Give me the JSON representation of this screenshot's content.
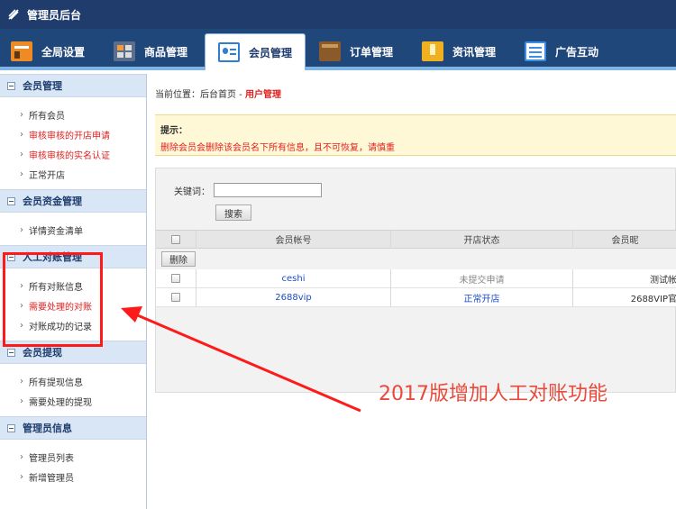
{
  "app": {
    "title": "管理员后台"
  },
  "nav": {
    "tabs": [
      {
        "label": "全局设置",
        "icon": "gear-panel-icon",
        "color": "#f08a24"
      },
      {
        "label": "商品管理",
        "icon": "grid-icon",
        "color": "#5b6f8c"
      },
      {
        "label": "会员管理",
        "icon": "member-card-icon",
        "color": "#2d7fd1"
      },
      {
        "label": "订单管理",
        "icon": "wallet-icon",
        "color": "#8a5a2b"
      },
      {
        "label": "资讯管理",
        "icon": "folder-icon",
        "color": "#f0b020"
      },
      {
        "label": "广告互动",
        "icon": "list-icon",
        "color": "#3a8ee6"
      }
    ],
    "active": "会员管理"
  },
  "sidebar": {
    "groups": [
      {
        "title": "会员管理",
        "items": [
          {
            "label": "所有会员",
            "red": false
          },
          {
            "label": "审核审核的开店申请",
            "red": true
          },
          {
            "label": "审核审核的实名认证",
            "red": true
          },
          {
            "label": "正常开店",
            "red": false
          }
        ]
      },
      {
        "title": "会员资金管理",
        "items": [
          {
            "label": "详情资金清单",
            "red": false
          }
        ]
      },
      {
        "title": "人工对账管理",
        "items": [
          {
            "label": "所有对账信息",
            "red": false
          },
          {
            "label": "需要处理的对账",
            "red": true
          },
          {
            "label": "对账成功的记录",
            "red": false
          }
        ]
      },
      {
        "title": "会员提现",
        "items": [
          {
            "label": "所有提现信息",
            "red": false
          },
          {
            "label": "需要处理的提现",
            "red": false
          }
        ]
      },
      {
        "title": "管理员信息",
        "items": [
          {
            "label": "管理员列表",
            "red": false
          },
          {
            "label": "新增管理员",
            "red": false
          }
        ]
      }
    ]
  },
  "breadcrumb": {
    "prefix": "当前位置：后台首页 - ",
    "current": "用户管理"
  },
  "tip": {
    "title": "提示：",
    "text": "删除会员会删除该会员名下所有信息，且不可恢复，请慎重"
  },
  "search": {
    "label": "关键词：",
    "value": "",
    "button": "搜索"
  },
  "table": {
    "columns": [
      "",
      "会员帐号",
      "开店状态",
      "会员昵"
    ],
    "delete_label": "删除",
    "rows": [
      {
        "account": "ceshi",
        "status": "未提交申请",
        "status_style": "gray",
        "nickname": "测试帐"
      },
      {
        "account": "2688vip",
        "status": "正常开店",
        "status_style": "blue",
        "nickname": "2688VIP官"
      }
    ]
  },
  "annotation": {
    "text": "2017版增加人工对账功能",
    "color": "#e84a3c",
    "box_color": "#ff1a1a"
  }
}
